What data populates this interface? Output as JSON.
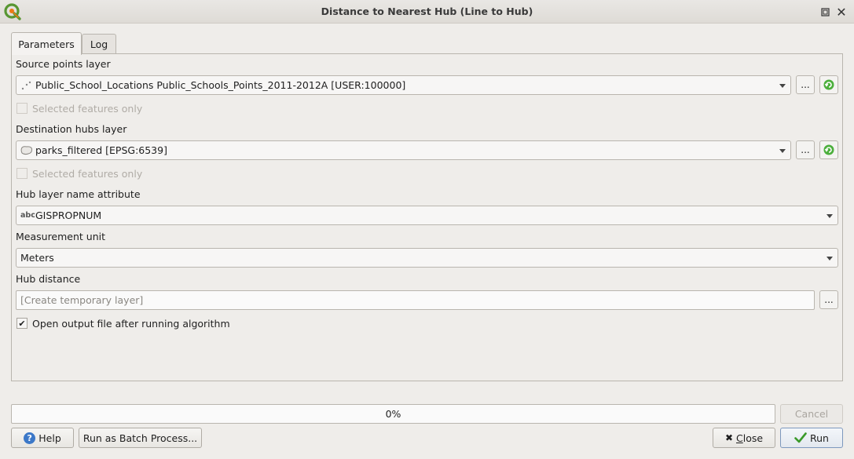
{
  "window": {
    "title": "Distance to Nearest Hub (Line to Hub)"
  },
  "tabs": [
    {
      "label": "Parameters"
    },
    {
      "label": "Log"
    }
  ],
  "form": {
    "source_points": {
      "label": "Source points layer",
      "value": "Public_School_Locations Public_Schools_Points_2011-2012A [USER:100000]",
      "icon": "point-layer-icon",
      "selected_only_label": "Selected features only"
    },
    "destination_hubs": {
      "label": "Destination hubs layer",
      "value": "parks_filtered [EPSG:6539]",
      "icon": "polygon-layer-icon",
      "selected_only_label": "Selected features only"
    },
    "hub_name_attr": {
      "label": "Hub layer name attribute",
      "value": "GISPROPNUM",
      "type_tag": "abc"
    },
    "measurement_unit": {
      "label": "Measurement unit",
      "value": "Meters"
    },
    "hub_distance": {
      "label": "Hub distance",
      "placeholder": "[Create temporary layer]"
    },
    "open_output": {
      "label": "Open output file after running algorithm",
      "checked": true
    },
    "browse_label": "..."
  },
  "progress": {
    "text": "0%",
    "value": 0
  },
  "buttons": {
    "cancel": "Cancel",
    "help": "Help",
    "batch": "Run as Batch Process...",
    "close_mnemonic": "C",
    "close_rest": "lose",
    "run": "Run"
  },
  "colors": {
    "accent": "#3c78c8",
    "run_check": "#3a9a2a",
    "refresh": "#4caf3c"
  }
}
